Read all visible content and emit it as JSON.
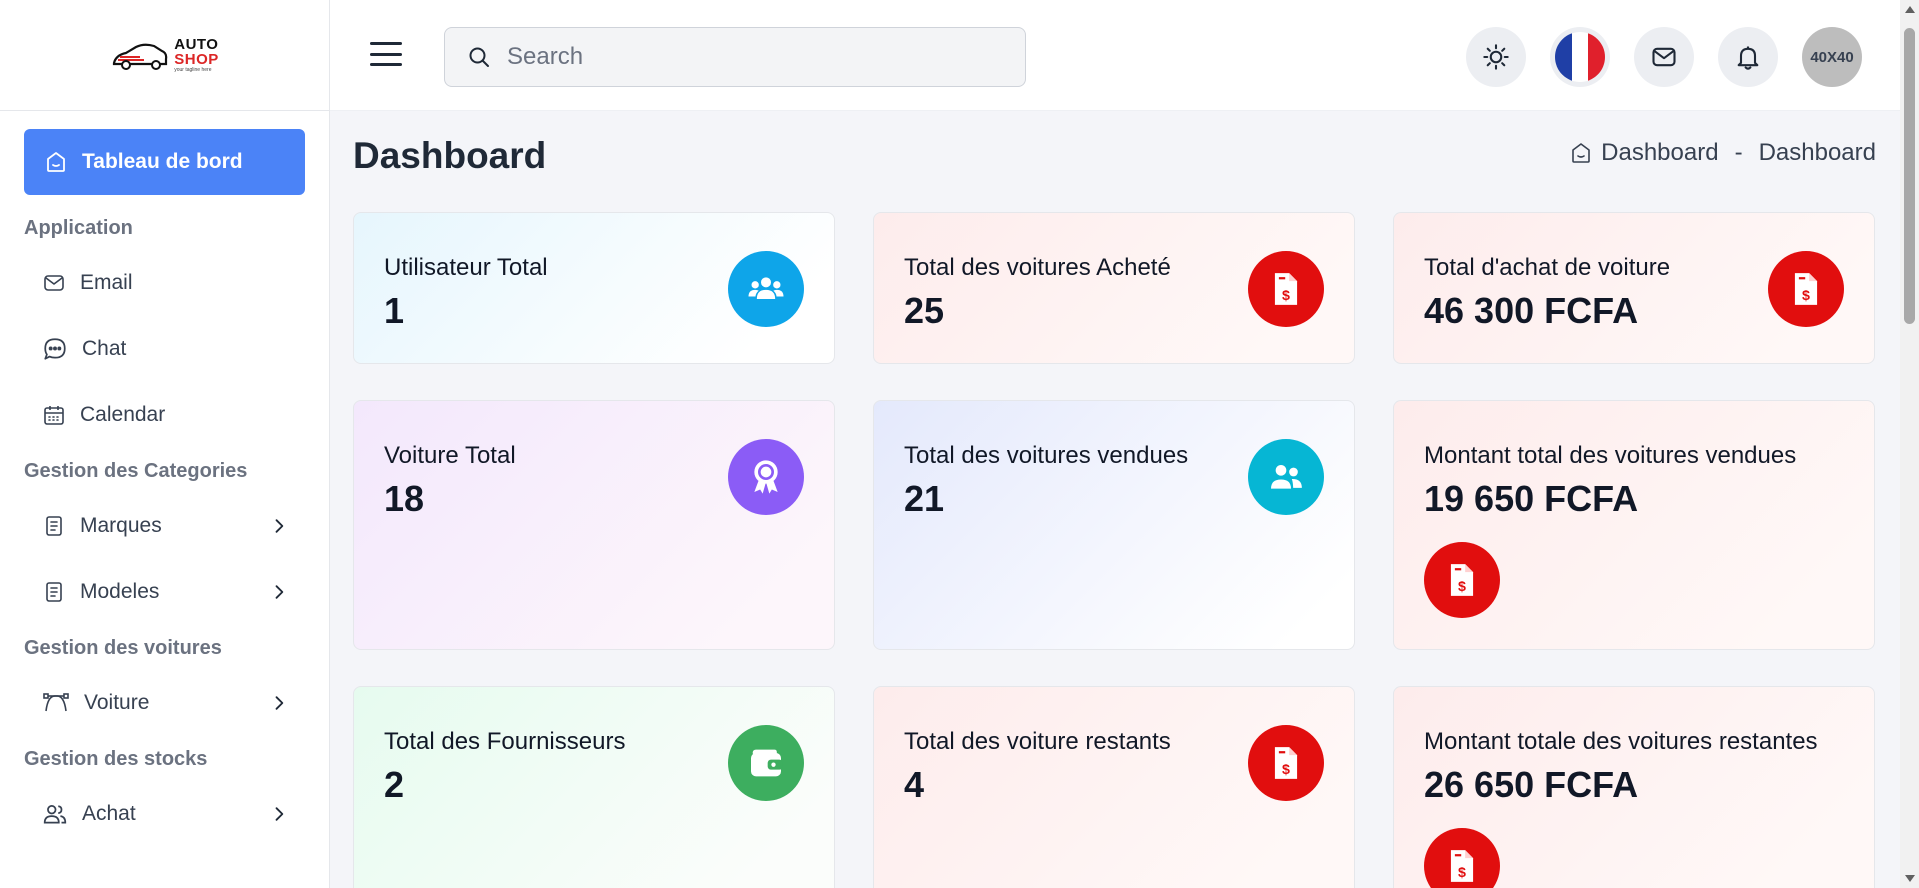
{
  "brand": {
    "line1": "AUTO",
    "line2": "SHOP",
    "tagline": "your tagline here"
  },
  "sidebar": {
    "active": {
      "label": "Tableau de bord",
      "icon": "home-icon"
    },
    "sections": [
      {
        "title": "Application",
        "items": [
          {
            "label": "Email",
            "icon": "mail-icon",
            "chevron": false
          },
          {
            "label": "Chat",
            "icon": "chat-icon",
            "chevron": false
          },
          {
            "label": "Calendar",
            "icon": "calendar-icon",
            "chevron": false
          }
        ]
      },
      {
        "title": "Gestion des Categories",
        "items": [
          {
            "label": "Marques",
            "icon": "document-icon",
            "chevron": true
          },
          {
            "label": "Modeles",
            "icon": "document-icon",
            "chevron": true
          }
        ]
      },
      {
        "title": "Gestion des voitures",
        "items": [
          {
            "label": "Voiture",
            "icon": "path-icon",
            "chevron": true
          }
        ]
      },
      {
        "title": "Gestion des stocks",
        "items": [
          {
            "label": "Achat",
            "icon": "users-icon",
            "chevron": true
          }
        ]
      }
    ]
  },
  "header": {
    "search_placeholder": "Search",
    "avatar_text": "40X40",
    "flag_colors": [
      "#1f3fa6",
      "#ffffff",
      "#e0202c"
    ]
  },
  "page": {
    "title": "Dashboard",
    "breadcrumb": [
      "Dashboard",
      "-",
      "Dashboard"
    ]
  },
  "cards": [
    {
      "title": "Utilisateur Total",
      "value": "1",
      "icon": "users-group-icon",
      "color": "#0ea5e9"
    },
    {
      "title": "Total des voitures Acheté",
      "value": "25",
      "icon": "invoice-dollar-icon",
      "color": "#e10e0e"
    },
    {
      "title": "Total d'achat de voiture",
      "value": "46 300 FCFA",
      "icon": "invoice-dollar-icon",
      "color": "#e10e0e"
    },
    {
      "title": "Voiture Total",
      "value": "18",
      "icon": "award-icon",
      "color": "#8b5cf6"
    },
    {
      "title": "Total des voitures vendues",
      "value": "21",
      "icon": "users-pair-icon",
      "color": "#06b6d4"
    },
    {
      "title": "Montant total des voitures vendues",
      "value": "19 650 FCFA",
      "icon": "invoice-dollar-icon",
      "color": "#e10e0e"
    },
    {
      "title": "Total des Fournisseurs",
      "value": "2",
      "icon": "wallet-icon",
      "color": "#3dae5f"
    },
    {
      "title": "Total des voiture restants",
      "value": "4",
      "icon": "invoice-dollar-icon",
      "color": "#e10e0e"
    },
    {
      "title": "Montant totale des voitures restantes",
      "value": "26 650 FCFA",
      "icon": "invoice-dollar-icon",
      "color": "#e10e0e"
    }
  ]
}
